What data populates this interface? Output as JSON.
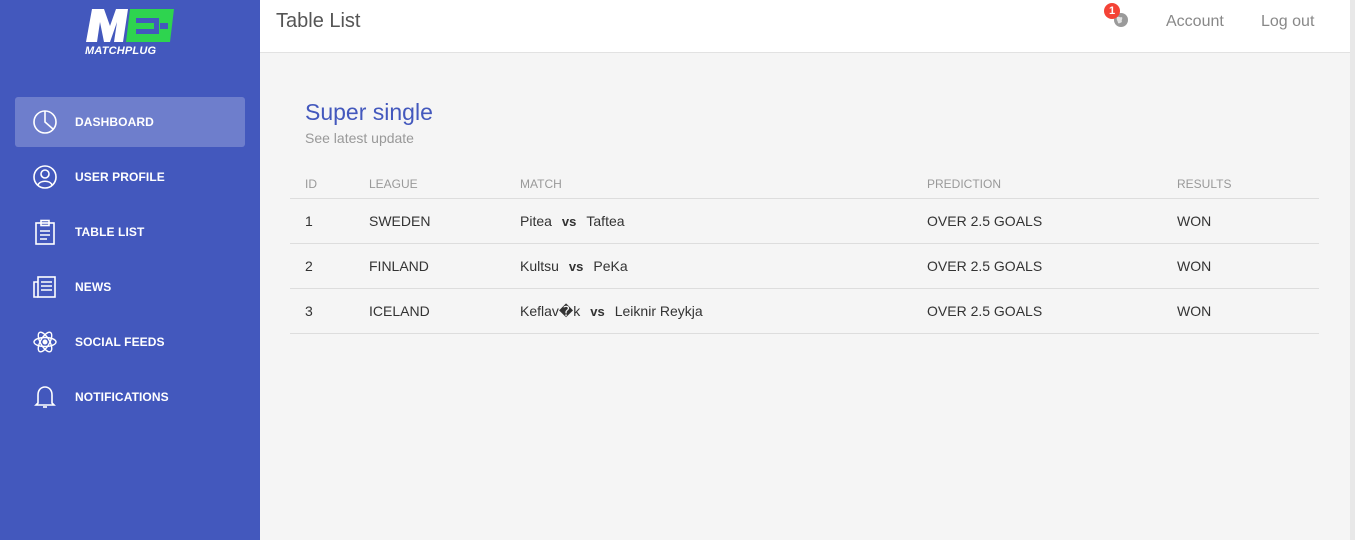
{
  "brand": {
    "logo_text": "MATCHPLUG",
    "accent": "#1db954",
    "sidebar_color": "#4358bd"
  },
  "sidebar": {
    "items": [
      {
        "label": "DASHBOARD",
        "icon": "pie-chart-icon",
        "active": true
      },
      {
        "label": "USER PROFILE",
        "icon": "user-circle-icon"
      },
      {
        "label": "TABLE LIST",
        "icon": "clipboard-icon"
      },
      {
        "label": "NEWS",
        "icon": "newspaper-icon"
      },
      {
        "label": "SOCIAL FEEDS",
        "icon": "atom-icon"
      },
      {
        "label": "NOTIFICATIONS",
        "icon": "bell-icon"
      }
    ]
  },
  "header": {
    "title": "Table List",
    "notification_count": "1",
    "account": "Account",
    "logout": "Log out"
  },
  "card": {
    "title": "Super single",
    "subtitle": "See latest update",
    "columns": [
      "ID",
      "LEAGUE",
      "MATCH",
      "PREDICTION",
      "RESULTS"
    ],
    "vs_label": "vs",
    "rows": [
      {
        "id": "1",
        "league": "SWEDEN",
        "home": "Pitea",
        "away": "Taftea",
        "prediction": "OVER 2.5 GOALS",
        "result": "WON"
      },
      {
        "id": "2",
        "league": "FINLAND",
        "home": "Kultsu",
        "away": "PeKa",
        "prediction": "OVER 2.5 GOALS",
        "result": "WON"
      },
      {
        "id": "3",
        "league": "ICELAND",
        "home": "Keflav�k",
        "away": "Leiknir Reykja",
        "prediction": "OVER 2.5 GOALS",
        "result": "WON"
      }
    ]
  }
}
